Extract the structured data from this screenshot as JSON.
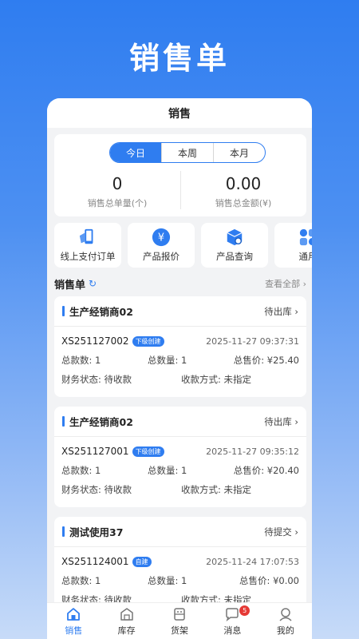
{
  "hero_title": "销售单",
  "header_title": "销售",
  "segments": [
    "今日",
    "本周",
    "本月"
  ],
  "stats": [
    {
      "value": "0",
      "label": "销售总单量(个)"
    },
    {
      "value": "0.00",
      "label": "销售总金额(¥)"
    }
  ],
  "quick_actions": [
    {
      "label": "线上支付订单",
      "icon": "mobile-pay-icon"
    },
    {
      "label": "产品报价",
      "icon": "yen-quote-icon"
    },
    {
      "label": "产品查询",
      "icon": "box-search-icon"
    },
    {
      "label": "通用",
      "icon": "general-icon"
    }
  ],
  "section": {
    "title": "销售单",
    "more": "查看全部"
  },
  "labels": {
    "total_items": "总款数:",
    "total_qty": "总数量:",
    "total_price": "总售价:",
    "finance": "财务状态:",
    "pay_method": "收款方式:"
  },
  "orders": [
    {
      "name": "生产经销商02",
      "status": "待出库",
      "no": "XS251127002",
      "badge": "下级创建",
      "date": "2025-11-27 09:37:31",
      "items": "1",
      "qty": "1",
      "price": "¥25.40",
      "finance": "待收款",
      "pay": "未指定"
    },
    {
      "name": "生产经销商02",
      "status": "待出库",
      "no": "XS251127001",
      "badge": "下级创建",
      "date": "2025-11-27 09:35:12",
      "items": "1",
      "qty": "1",
      "price": "¥20.40",
      "finance": "待收款",
      "pay": "未指定"
    },
    {
      "name": "测试使用37",
      "status": "待提交",
      "no": "XS251124001",
      "badge": "自建",
      "date": "2025-11-24 17:07:53",
      "items": "1",
      "qty": "1",
      "price": "¥0.00",
      "finance": "待收款",
      "pay": "未指定"
    }
  ],
  "tabs": [
    {
      "label": "销售",
      "active": true
    },
    {
      "label": "库存"
    },
    {
      "label": "货架"
    },
    {
      "label": "消息",
      "badge": "5"
    },
    {
      "label": "我的"
    }
  ],
  "colors": {
    "accent": "#2f7df0",
    "badge_red": "#e53935"
  }
}
